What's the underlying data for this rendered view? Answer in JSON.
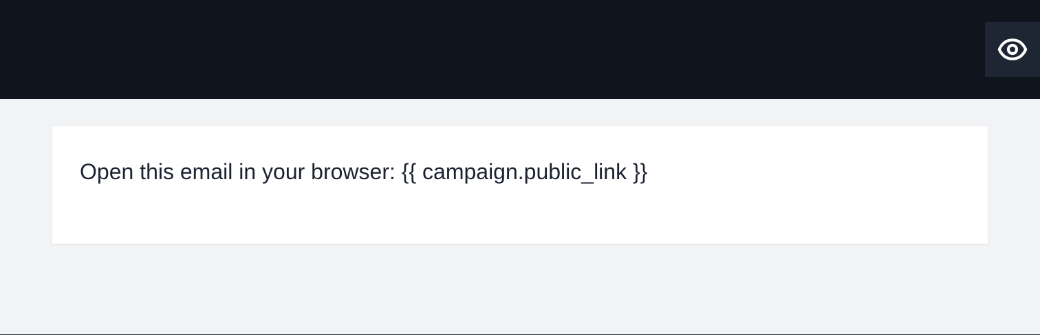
{
  "header": {
    "preview_button": {
      "icon": "eye-icon",
      "background": "#1f2633"
    },
    "background": "#10141d"
  },
  "email": {
    "body_text": "Open this email in your browser: {{ campaign.public_link }}"
  }
}
